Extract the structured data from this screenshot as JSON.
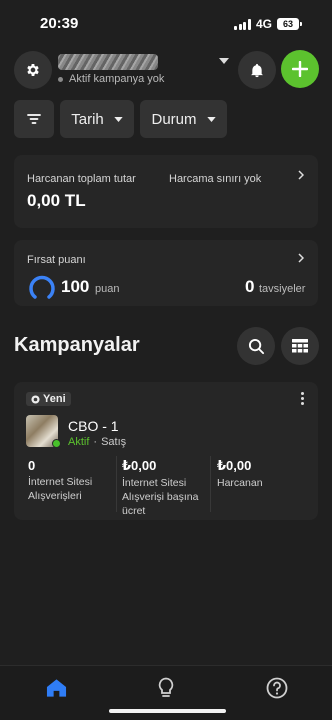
{
  "status_bar": {
    "time": "20:39",
    "network": "4G",
    "battery": "63"
  },
  "header": {
    "account_name": "",
    "account_status": "Aktif kampanya yok"
  },
  "filters": {
    "date_label": "Tarih",
    "status_label": "Durum"
  },
  "spend": {
    "label": "Harcanan toplam tutar",
    "value": "0,00 TL",
    "limit_label": "Harcama sınırı yok"
  },
  "points": {
    "label": "Fırsat puanı",
    "value": "100",
    "unit": "puan",
    "rec_value": "0",
    "rec_label": "tavsiyeler"
  },
  "campaigns": {
    "title": "Kampanyalar",
    "items": [
      {
        "badge": "Yeni",
        "name": "CBO - 1",
        "status": "Aktif",
        "objective": "Satış",
        "metrics": [
          {
            "value": "0",
            "label": "İnternet Sitesi Alışverişleri"
          },
          {
            "value": "₺0,00",
            "label": "İnternet Sitesi Alışverişi başına ücret"
          },
          {
            "value": "₺0,00",
            "label": "Harcanan"
          }
        ]
      }
    ]
  },
  "colors": {
    "background": "#1f1f1f",
    "card": "#262626",
    "accent_green": "#5cc22e",
    "ring_blue": "#3b82f6"
  },
  "nav": {
    "items": [
      "home-icon",
      "lightbulb-icon",
      "help-icon"
    ],
    "active": "home-icon"
  }
}
